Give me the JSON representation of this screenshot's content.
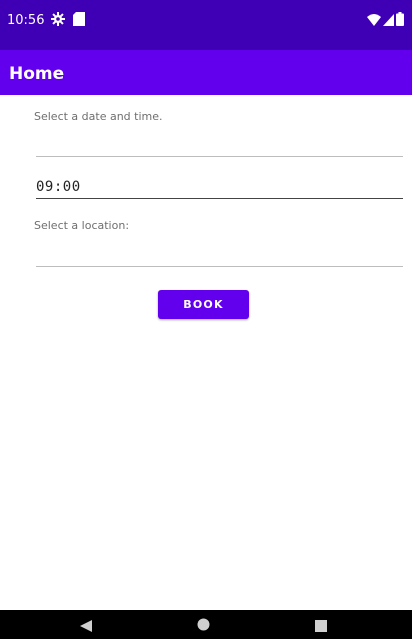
{
  "status_bar": {
    "time": "10:56",
    "icons": [
      "gear-icon",
      "sd-card-icon",
      "wifi-icon",
      "signal-icon",
      "battery-icon"
    ]
  },
  "app_bar": {
    "title": "Home"
  },
  "form": {
    "date_time_label": "Select a date and time.",
    "time_value": "09:00",
    "location_label": "Select a location:",
    "book_button": "BOOK"
  },
  "nav_bar": {
    "icons": [
      "back-icon",
      "home-icon",
      "recents-icon"
    ]
  },
  "colors": {
    "primary": "#6200ee",
    "primary_dark": "#3f00b5"
  }
}
